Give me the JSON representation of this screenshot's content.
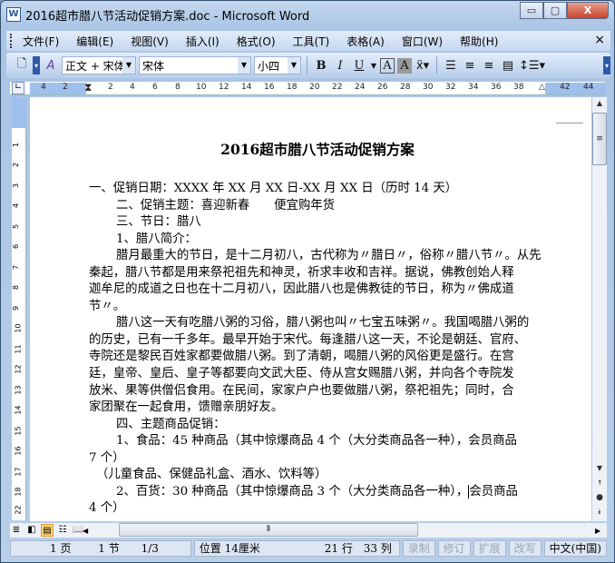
{
  "window": {
    "title": "2016超市腊八节活动促销方案.doc - Microsoft Word",
    "app_icon": "W",
    "minimize": "▭",
    "maximize": "▢",
    "close": "X"
  },
  "menu": {
    "items": [
      "文件(F)",
      "编辑(E)",
      "视图(V)",
      "插入(I)",
      "格式(O)",
      "工具(T)",
      "表格(A)",
      "窗口(W)",
      "帮助(H)"
    ],
    "close": "×"
  },
  "toolbar": {
    "style": "正文 + 宋体",
    "font": "宋体",
    "size": "小四",
    "bold": "B",
    "italic": "I",
    "underline": "U",
    "char_border": "A",
    "char_shading": "A"
  },
  "ruler": {
    "left": [
      "4",
      "2"
    ],
    "ticks": [
      "2",
      "4",
      "6",
      "8",
      "10",
      "12",
      "14",
      "16",
      "18",
      "20",
      "22",
      "24",
      "26",
      "28",
      "30",
      "32",
      "34",
      "36",
      "38"
    ],
    "right": [
      "42",
      "44"
    ],
    "vertical": [
      "1",
      "2",
      "3",
      "4",
      "5",
      "6",
      "7",
      "8",
      "9",
      "10",
      "11",
      "12",
      "13",
      "14",
      "15",
      "16",
      "17",
      "18",
      "19",
      "20",
      "21",
      "22"
    ]
  },
  "document": {
    "title": "2016超市腊八节活动促销方案",
    "lines": [
      {
        "t": "一、促销日期：XXXX 年 XX 月 XX 日-XX 月 XX 日（历时 14 天）",
        "c": ""
      },
      {
        "t": "二、促销主题：喜迎新春　　便宜购年货",
        "c": "i1"
      },
      {
        "t": "三、节日：腊八",
        "c": "i1"
      },
      {
        "t": "1、腊八简介：",
        "c": "i1"
      },
      {
        "t": "腊月最重大的节日，是十二月初八，古代称为〃腊日〃，俗称〃腊八节〃。从先",
        "c": "i1"
      },
      {
        "t": "秦起，腊八节都是用来祭祀祖先和神灵，祈求丰收和吉祥。据说，佛教创始人释",
        "c": ""
      },
      {
        "t": "迦牟尼的成道之日也在十二月初八，因此腊八也是佛教徒的节日，称为〃佛成道",
        "c": ""
      },
      {
        "t": "节〃。",
        "c": ""
      },
      {
        "t": "腊八这一天有吃腊八粥的习俗，腊八粥也叫〃七宝五味粥〃。我国喝腊八粥的",
        "c": "i1"
      },
      {
        "t": "的历史，已有一千多年。最早开始于宋代。每逢腊八这一天，不论是朝廷、官府、",
        "c": ""
      },
      {
        "t": "寺院还是黎民百姓家都要做腊八粥。到了清朝，喝腊八粥的风俗更是盛行。在宫",
        "c": ""
      },
      {
        "t": "廷，皇帝、皇后、皇子等都要向文武大臣、侍从宫女赐腊八粥，并向各个寺院发",
        "c": ""
      },
      {
        "t": "放米、果等供僧侣食用。在民间，家家户户也要做腊八粥，祭祀祖先；同时，合",
        "c": ""
      },
      {
        "t": "家团聚在一起食用，馈赠亲朋好友。",
        "c": ""
      },
      {
        "t": "四、主题商品促销：",
        "c": "i1"
      },
      {
        "t": "1、食品：45 种商品（其中惊爆商品 4 个（大分类商品各一种），会员商品",
        "c": "i1"
      },
      {
        "t": "7 个）",
        "c": ""
      },
      {
        "t": "（儿童食品、保健品礼盒、酒水、饮料等）",
        "c": "i2"
      },
      {
        "t": "2、百货：30 种商品（其中惊爆商品 3 个（大分类商品各一种），",
        "t2": "会员商品",
        "c": "i1"
      },
      {
        "t": "4 个）",
        "c": ""
      }
    ]
  },
  "status": {
    "page": "1 页",
    "section": "1 节",
    "pages": "1/3",
    "position": "位置 14厘米",
    "line": "21 行",
    "col": "33 列",
    "rec": "录制",
    "trk": "修订",
    "ext": "扩展",
    "ovr": "改写",
    "lang": "中文(中国)"
  }
}
